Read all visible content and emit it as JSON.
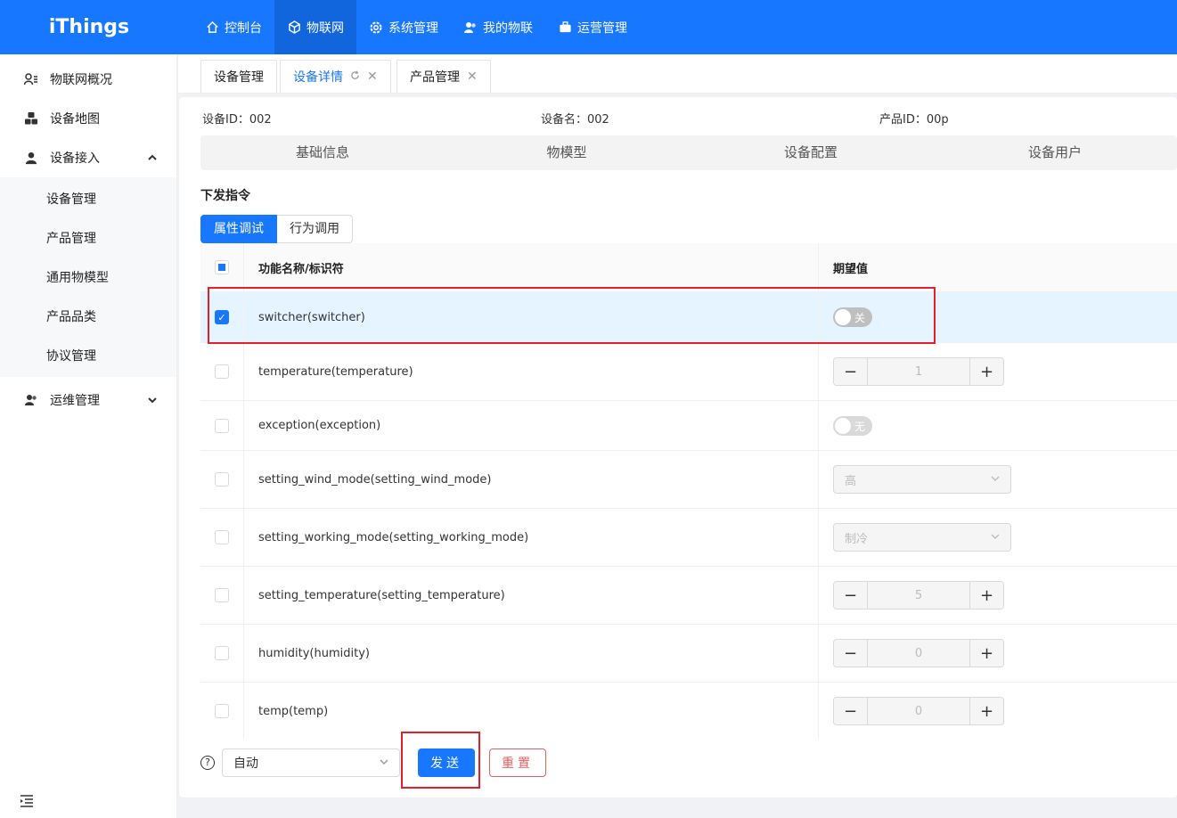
{
  "app": {
    "logo": "iThings"
  },
  "topnav": [
    {
      "label": "控制台",
      "icon": "home-icon"
    },
    {
      "label": "物联网",
      "icon": "cube-icon",
      "active": true
    },
    {
      "label": "系统管理",
      "icon": "gear-icon"
    },
    {
      "label": "我的物联",
      "icon": "users-icon"
    },
    {
      "label": "运营管理",
      "icon": "briefcase-icon"
    }
  ],
  "sidebar": {
    "items": [
      {
        "label": "物联网概况",
        "icon": "user-list-icon"
      },
      {
        "label": "设备地图",
        "icon": "cluster-icon"
      },
      {
        "label": "设备接入",
        "icon": "user-icon",
        "expanded": true
      }
    ],
    "submenu": [
      "设备管理",
      "产品管理",
      "通用物模型",
      "产品品类",
      "协议管理"
    ],
    "ops": {
      "label": "运维管理",
      "icon": "users-icon"
    }
  },
  "tabs": [
    {
      "label": "设备管理"
    },
    {
      "label": "设备详情",
      "active": true
    },
    {
      "label": "产品管理"
    }
  ],
  "device": {
    "id_text": "设备ID：002",
    "name_text": "设备名：002",
    "product_text": "产品ID：00p"
  },
  "subtabs": [
    "基础信息",
    "物模型",
    "设备配置",
    "设备用户"
  ],
  "section_title": "下发指令",
  "segment": {
    "on": "属性调试",
    "off": "行为调用"
  },
  "table": {
    "header": {
      "name": "功能名称/标识符",
      "value": "期望值"
    },
    "rows": [
      {
        "name": "switcher(switcher)",
        "type": "switch",
        "value": "关",
        "checked": true
      },
      {
        "name": "temperature(temperature)",
        "type": "stepper",
        "value": "1"
      },
      {
        "name": "exception(exception)",
        "type": "switch",
        "value": "无"
      },
      {
        "name": "setting_wind_mode(setting_wind_mode)",
        "type": "select",
        "value": "高"
      },
      {
        "name": "setting_working_mode(setting_working_mode)",
        "type": "select",
        "value": "制冷"
      },
      {
        "name": "setting_temperature(setting_temperature)",
        "type": "stepper",
        "value": "5"
      },
      {
        "name": "humidity(humidity)",
        "type": "stepper",
        "value": "0"
      },
      {
        "name": "temp(temp)",
        "type": "stepper",
        "value": "0"
      }
    ]
  },
  "footer": {
    "help": "?",
    "mode": "自动",
    "send": "发送",
    "reset": "重置"
  },
  "colors": {
    "primary": "#1777ff",
    "highlight": "#e0202a",
    "danger": "#e06060"
  }
}
